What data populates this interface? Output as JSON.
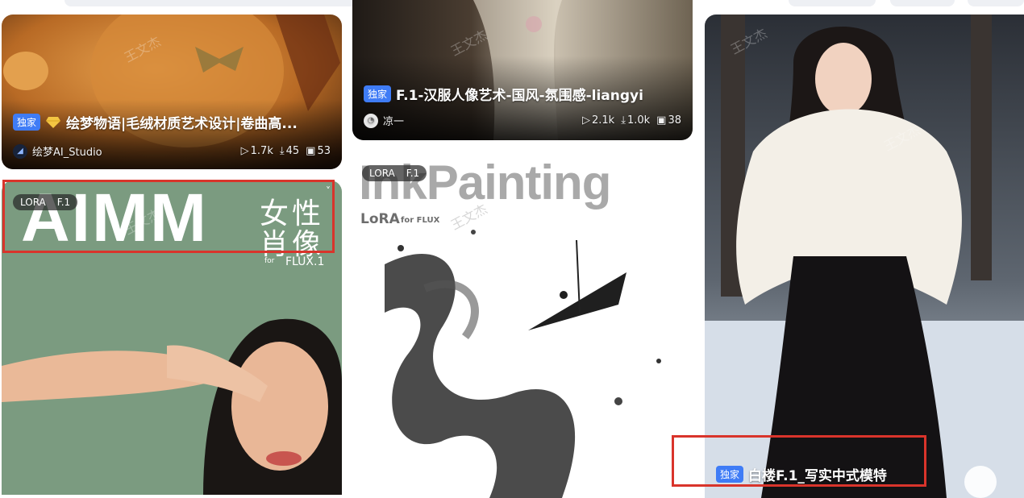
{
  "cards": [
    {
      "badge": "独家",
      "gem_icon": "gem-icon",
      "title": "绘梦物语|毛绒材质艺术设计|卷曲高...",
      "author": "绘梦AI_Studio",
      "views": "1.7k",
      "downloads": "45",
      "images": "53"
    },
    {
      "tag_type": "LORA",
      "tag_version": "F.1",
      "cover_title_en": "AIMM",
      "cover_title_cn_1": "女性",
      "cover_title_cn_2": "肖像",
      "cover_sub_for": "for",
      "cover_sub": "FLUX.1"
    },
    {
      "badge": "独家",
      "title": "F.1-汉服人像艺术-国风-氛围感-liangyi",
      "author": "凉一",
      "views": "2.1k",
      "downloads": "1.0k",
      "images": "38"
    },
    {
      "tag_type": "LORA",
      "tag_version": "F.1",
      "cover_title": "InkPainting",
      "cover_sub": "LoRA",
      "cover_sub_for": "for FLUX"
    },
    {
      "badge": "独家",
      "title": "白楼F.1_写实中式模特"
    }
  ],
  "watermark_text": "王文杰",
  "colors": {
    "accent": "#3f7cf6",
    "highlight": "#d9342b"
  }
}
